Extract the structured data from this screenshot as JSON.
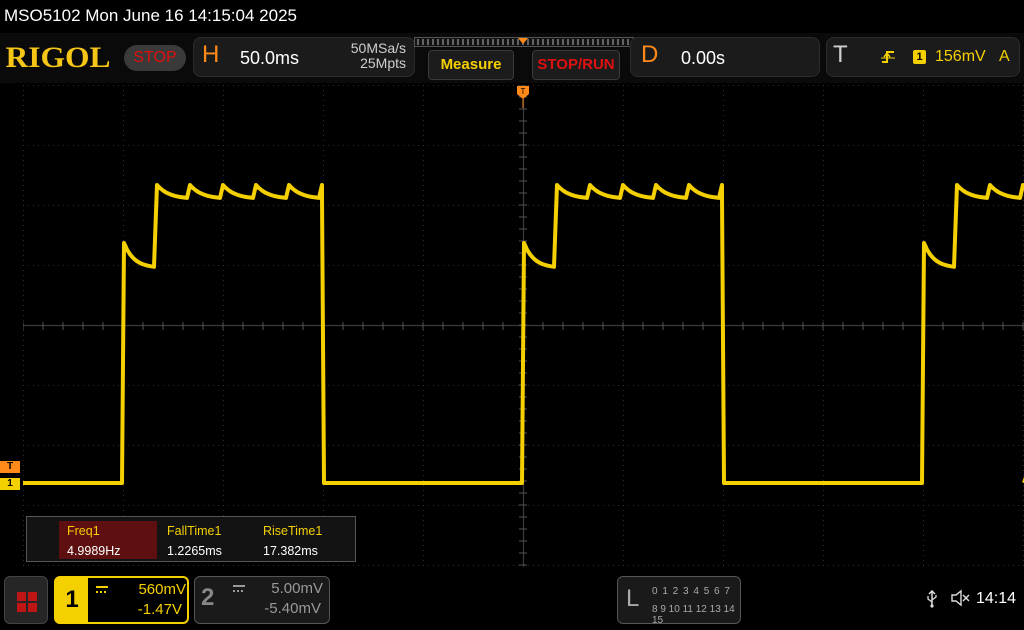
{
  "titlebar": {
    "text": "MSO5102  Mon June 16 14:15:04 2025"
  },
  "topbar": {
    "logo": "RIGOL",
    "status": "STOP",
    "horizontal": {
      "letter": "H",
      "scale": "50.0ms",
      "sample_rate": "50MSa/s",
      "memory_depth": "25Mpts"
    },
    "measure_label": "Measure",
    "stoprun_label": "STOP/RUN",
    "delay": {
      "letter": "D",
      "value": "0.00s"
    },
    "trigger": {
      "letter": "T",
      "source": "1",
      "level": "156mV",
      "mode": "A"
    }
  },
  "markers": {
    "trigger_top": "T",
    "trigger_level": "T",
    "channel1": "1"
  },
  "measurements": [
    {
      "label": "Freq1",
      "value": "4.9989Hz"
    },
    {
      "label": "FallTime1",
      "value": "1.2265ms"
    },
    {
      "label": "RiseTime1",
      "value": "17.382ms"
    }
  ],
  "channels": [
    {
      "number": "1",
      "scale": "560mV",
      "offset": "-1.47V",
      "active": true
    },
    {
      "number": "2",
      "scale": "5.00mV",
      "offset": "-5.40mV",
      "active": false
    }
  ],
  "la": {
    "letter": "L",
    "row1": "0 1 2 3  4 5 6 7",
    "row2": "8 9 10 11 12 13 14 15"
  },
  "status": {
    "clock": "14:14"
  },
  "colors": {
    "ch1": "#f5d000",
    "trigger": "#ff8a1a",
    "grid": "#3a3a3a",
    "logo": "#f5c518"
  },
  "icons": [
    "home-grid-icon",
    "usb-icon",
    "speaker-muted-icon",
    "trigger-rising-edge-icon"
  ]
}
